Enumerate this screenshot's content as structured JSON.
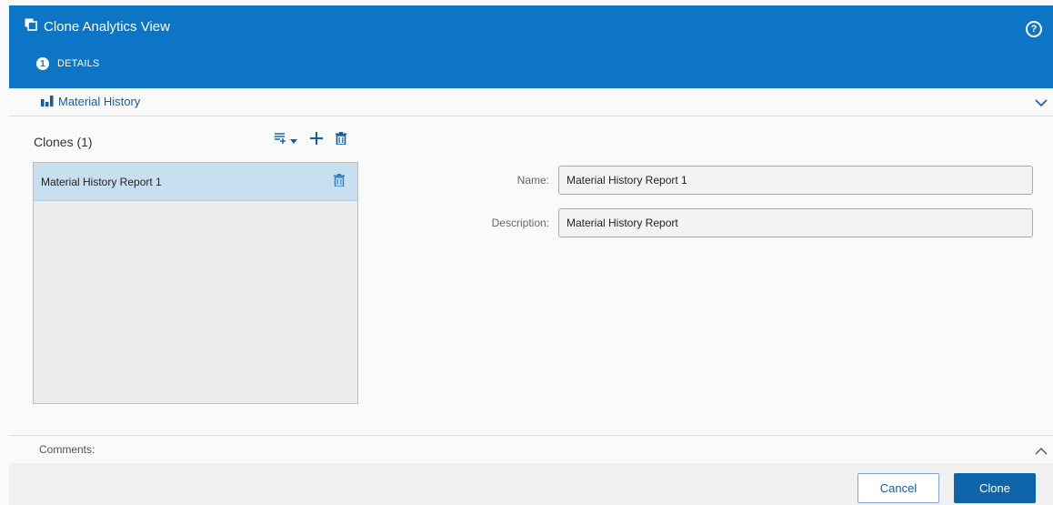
{
  "header": {
    "title": "Clone Analytics View",
    "help_glyph": "?",
    "step_number": "1",
    "step_label": "DETAILS",
    "brand_color": "#0c75c5"
  },
  "section": {
    "title": "Material History",
    "icon": "bar-chart-icon",
    "chevron": "chevron-down-icon"
  },
  "clones": {
    "title": "Clones (1)",
    "tools": [
      "add-from-list-icon",
      "dropdown-caret-icon",
      "plus-icon",
      "trash-icon"
    ],
    "items": [
      {
        "label": "Material History Report 1",
        "selected": true
      }
    ]
  },
  "form": {
    "name_label": "Name:",
    "name_value": "Material History Report 1",
    "description_label": "Description:",
    "description_value": "Material History Report"
  },
  "comments": {
    "label": "Comments:",
    "chevron": "chevron-up-icon"
  },
  "footer": {
    "cancel_label": "Cancel",
    "clone_label": "Clone"
  }
}
